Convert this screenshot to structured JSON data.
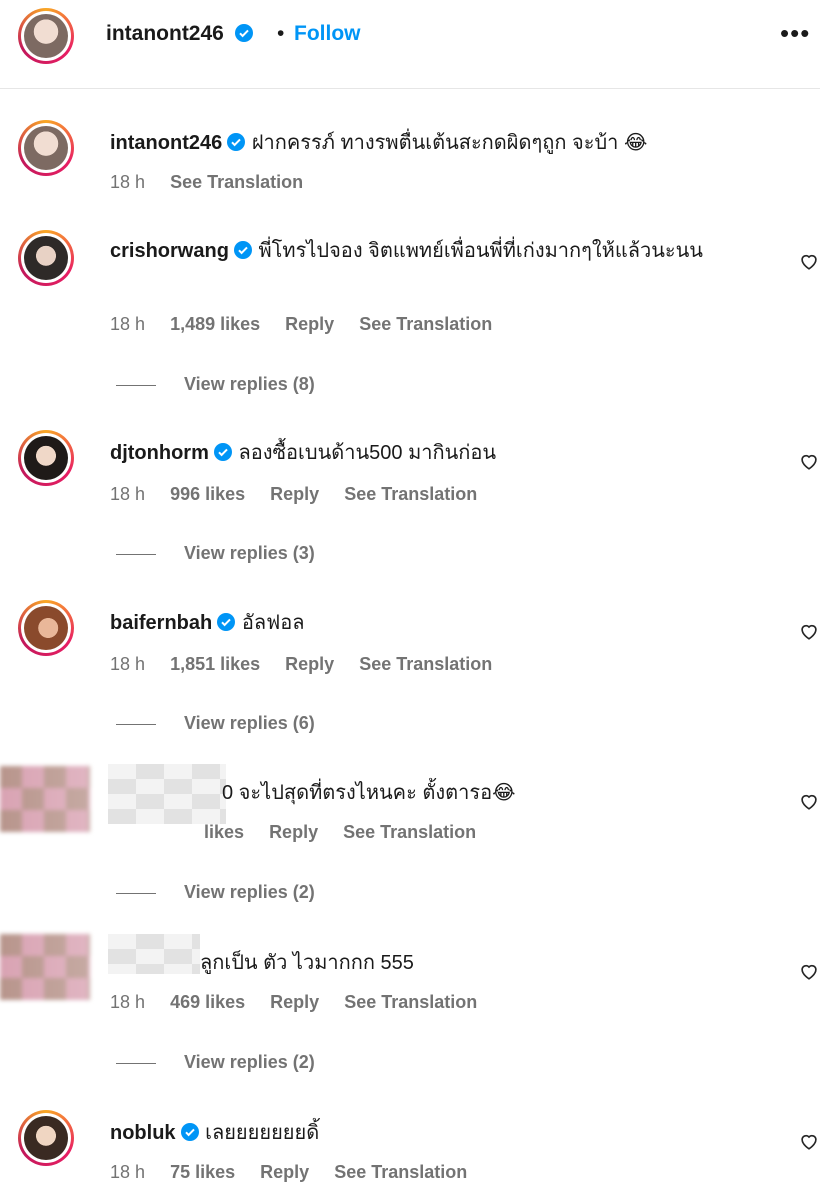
{
  "header": {
    "username": "intanont246",
    "separator": "•",
    "follow_label": "Follow",
    "more_label": "•••"
  },
  "comments": [
    {
      "username": "intanont246",
      "text": "ฝากครรภ์ ทางรพตื่นเต้นสะกดผิดๆถูก จะบ้า 😂",
      "time": "18 h",
      "likes": "",
      "reply_label": "",
      "translate_label": "See Translation"
    },
    {
      "username": "crishorwang",
      "text": "พี่โทรไปจอง จิตแพทย์เพื่อนพี่ที่เก่งมากๆให้แล้วนะนน",
      "time": "18 h",
      "likes": "1,489 likes",
      "reply_label": "Reply",
      "translate_label": "See Translation",
      "view_replies": "View replies (8)"
    },
    {
      "username": "djtonhorm",
      "text": "ลองซื้อเบนด้าน500 มากินก่อน",
      "time": "18 h",
      "likes": "996 likes",
      "reply_label": "Reply",
      "translate_label": "See Translation",
      "view_replies": "View replies (3)"
    },
    {
      "username": "baifernbah",
      "text": "อัลฟอล",
      "time": "18 h",
      "likes": "1,851 likes",
      "reply_label": "Reply",
      "translate_label": "See Translation",
      "view_replies": "View replies (6)"
    },
    {
      "username": "",
      "text": "0 จะไปสุดที่ตรงไหนคะ ตั้งตารอ😂",
      "time": "",
      "likes": "likes",
      "reply_label": "Reply",
      "translate_label": "See Translation",
      "view_replies": "View replies (2)"
    },
    {
      "username": "",
      "text": "ลูกเป็น ตัว ไวมากกก 555",
      "time": "18 h",
      "likes": "469 likes",
      "reply_label": "Reply",
      "translate_label": "See Translation",
      "view_replies": "View replies (2)"
    },
    {
      "username": "nobluk",
      "text": "เลยยยยยยยดิ้",
      "time": "18 h",
      "likes": "75 likes",
      "reply_label": "Reply",
      "translate_label": "See Translation"
    }
  ],
  "colors": {
    "link_blue": "#0095f6",
    "verified_blue": "#0095f6",
    "meta_gray": "#737373"
  }
}
